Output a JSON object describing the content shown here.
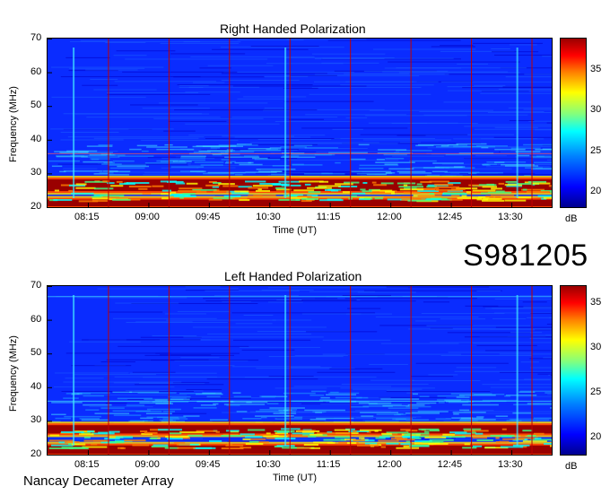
{
  "stamp": "S981205",
  "footer": "Nancay Decameter Array",
  "chart_data": [
    {
      "type": "heatmap",
      "title": "Right Handed Polarization",
      "xlabel": "Time (UT)",
      "ylabel": "Frequency (MHz)",
      "x_tick_labels": [
        "08:15",
        "09:00",
        "09:45",
        "10:30",
        "11:15",
        "12:00",
        "12:45",
        "13:30"
      ],
      "y_tick_labels": [
        "20",
        "30",
        "40",
        "50",
        "60",
        "70"
      ],
      "ylim": [
        20,
        70
      ],
      "colorbar": {
        "unit": "dB",
        "ticks": [
          "20",
          "25",
          "30",
          "35"
        ],
        "range": [
          18,
          39
        ]
      },
      "marker_times": [
        "08:30",
        "09:15",
        "10:00",
        "10:45",
        "11:30",
        "12:15",
        "13:00",
        "13:45"
      ],
      "strong_bands_mhz": [
        [
          24.5,
          28.5
        ],
        [
          20,
          22.5
        ]
      ],
      "colors": {
        "low": "#0000ff",
        "mid": "#00ffff",
        "high": "#9a0000",
        "marker": "#c00000"
      }
    },
    {
      "type": "heatmap",
      "title": "Left Handed Polarization",
      "xlabel": "Time (UT)",
      "ylabel": "Frequency (MHz)",
      "x_tick_labels": [
        "08:15",
        "09:00",
        "09:45",
        "10:30",
        "11:15",
        "12:00",
        "12:45",
        "13:30"
      ],
      "y_tick_labels": [
        "20",
        "30",
        "40",
        "50",
        "60",
        "70"
      ],
      "ylim": [
        20,
        70
      ],
      "colorbar": {
        "unit": "dB",
        "ticks": [
          "20",
          "25",
          "30",
          "35"
        ],
        "range": [
          18,
          37
        ]
      },
      "marker_times": [
        "08:30",
        "09:15",
        "10:00",
        "10:45",
        "11:30",
        "12:15",
        "13:00",
        "13:45"
      ],
      "strong_bands_mhz": [
        [
          26,
          29
        ],
        [
          20,
          23
        ]
      ],
      "colors": {
        "low": "#0000ff",
        "mid": "#00ffff",
        "high": "#9a0000",
        "marker": "#c00000"
      }
    }
  ]
}
